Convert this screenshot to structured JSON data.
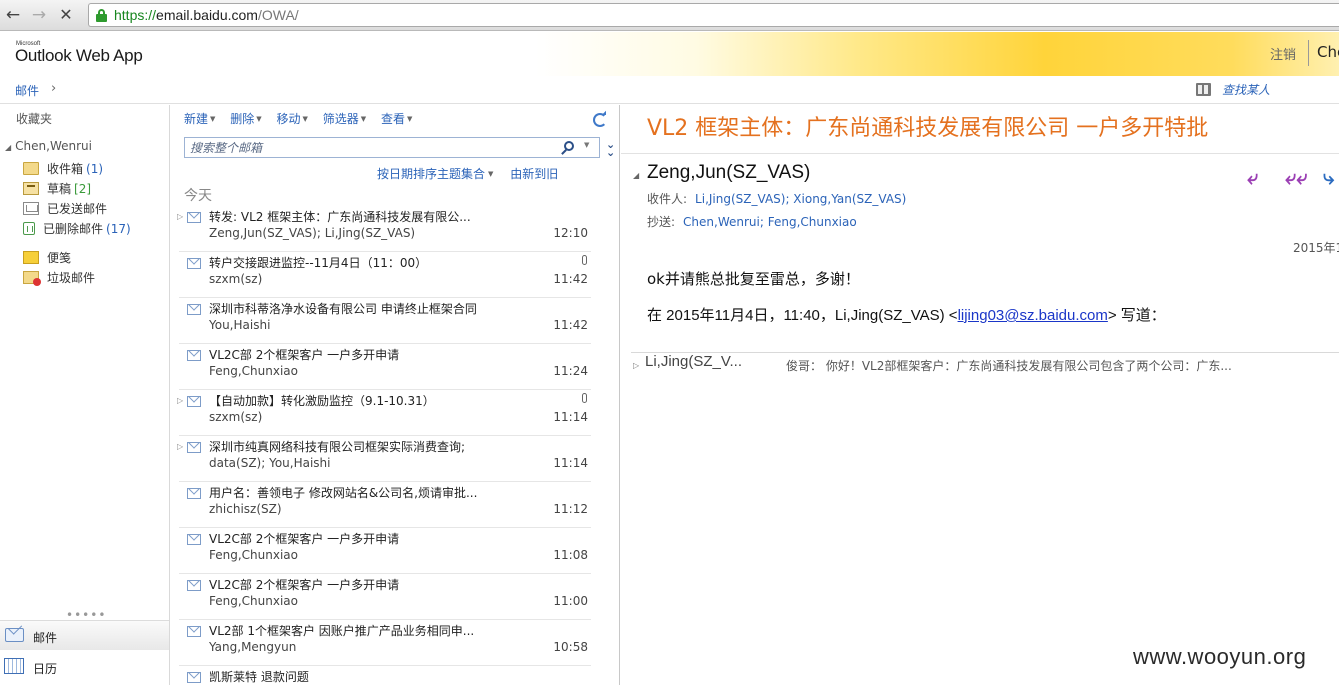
{
  "browser": {
    "url_scheme": "https://",
    "url_host": "email.baidu.com",
    "url_path": "/OWA/"
  },
  "header": {
    "brand_small": "Microsoft",
    "brand": "Outlook Web App",
    "logout": "注销",
    "user_truncated": "Che"
  },
  "breadcrumb": {
    "mail": "邮件",
    "chevron": "›",
    "find_people": "查找某人"
  },
  "leftnav": {
    "favorites": "收藏夹",
    "account": "Chen,Wenrui",
    "folders": [
      {
        "name": "收件箱",
        "count": "(1)",
        "icon": "inbox-icon"
      },
      {
        "name": "草稿",
        "count": "[2]",
        "icon": "drafts-icon"
      },
      {
        "name": "已发送邮件",
        "count": "",
        "icon": "sent-icon"
      },
      {
        "name": "已删除邮件",
        "count": "(17)",
        "icon": "deleted-icon"
      },
      {
        "name": "便笺",
        "count": "",
        "icon": "notes-icon"
      },
      {
        "name": "垃圾邮件",
        "count": "",
        "icon": "junk-icon"
      }
    ],
    "grip": "•••••",
    "modules": {
      "mail": "邮件",
      "calendar": "日历"
    }
  },
  "toolbar": {
    "new": "新建",
    "delete": "删除",
    "move": "移动",
    "filter": "筛选器",
    "view": "查看"
  },
  "search": {
    "placeholder": "搜索整个邮箱"
  },
  "sort": {
    "by": "按日期排序主题集合",
    "order": "由新到旧"
  },
  "group_header": "今天",
  "messages": [
    {
      "subject": "转发: VL2 框架主体：广东尚通科技发展有限公...",
      "sender": "Zeng,Jun(SZ_VAS); Li,Jing(SZ_VAS)",
      "time": "12:10",
      "conversation": true,
      "attachment": false
    },
    {
      "subject": "转户交接跟进监控--11月4日（11：00）",
      "sender": "szxm(sz)",
      "time": "11:42",
      "conversation": false,
      "attachment": true
    },
    {
      "subject": "深圳市科蒂洛净水设备有限公司 申请终止框架合同",
      "sender": "You,Haishi",
      "time": "11:42",
      "conversation": false,
      "attachment": false
    },
    {
      "subject": "VL2C部 2个框架客户 一户多开申请",
      "sender": "Feng,Chunxiao",
      "time": "11:24",
      "conversation": false,
      "attachment": false
    },
    {
      "subject": "【自动加款】转化激励监控（9.1-10.31）",
      "sender": "szxm(sz)",
      "time": "11:14",
      "conversation": true,
      "attachment": true
    },
    {
      "subject": "深圳市纯真网络科技有限公司框架实际消费查询;",
      "sender": "data(SZ); You,Haishi",
      "time": "11:14",
      "conversation": true,
      "attachment": false
    },
    {
      "subject": "用户名：善领电子 修改网站名&公司名,烦请审批...",
      "sender": "zhichisz(SZ)",
      "time": "11:12",
      "conversation": false,
      "attachment": false
    },
    {
      "subject": "VL2C部 2个框架客户 一户多开申请",
      "sender": "Feng,Chunxiao",
      "time": "11:08",
      "conversation": false,
      "attachment": false
    },
    {
      "subject": "VL2C部 2个框架客户 一户多开申请",
      "sender": "Feng,Chunxiao",
      "time": "11:00",
      "conversation": false,
      "attachment": false
    },
    {
      "subject": "VL2部 1个框架客户 因账户推广产品业务相同申...",
      "sender": "Yang,Mengyun",
      "time": "10:58",
      "conversation": false,
      "attachment": false
    },
    {
      "subject": "凯斯莱特 退款问题",
      "sender": "",
      "time": "",
      "conversation": false,
      "attachment": false
    }
  ],
  "reading": {
    "subject": "VL2 框架主体：广东尚通科技发展有限公司 一户多开特批",
    "from": "Zeng,Jun(SZ_VAS)",
    "to_label": "收件人:",
    "to": "Li,Jing(SZ_VAS); Xiong,Yan(SZ_VAS)",
    "cc_label": "抄送:",
    "cc": "Chen,Wenrui; Feng,Chunxiao",
    "date_truncated": "2015年1",
    "body_line1": "ok并请熊总批复至雷总，多谢！",
    "quote_prefix": "在 2015年11月4日，11:40，Li,Jing(SZ_VAS) <",
    "quote_email": "lijing03@sz.baidu.com",
    "quote_suffix": "> 写道：",
    "thread_sender": "Li,Jing(SZ_V...",
    "thread_preview": "俊哥：  你好！VL2部框架客户：广东尚通科技发展有限公司包含了两个公司：广东..."
  },
  "watermark": "www.wooyun.org"
}
